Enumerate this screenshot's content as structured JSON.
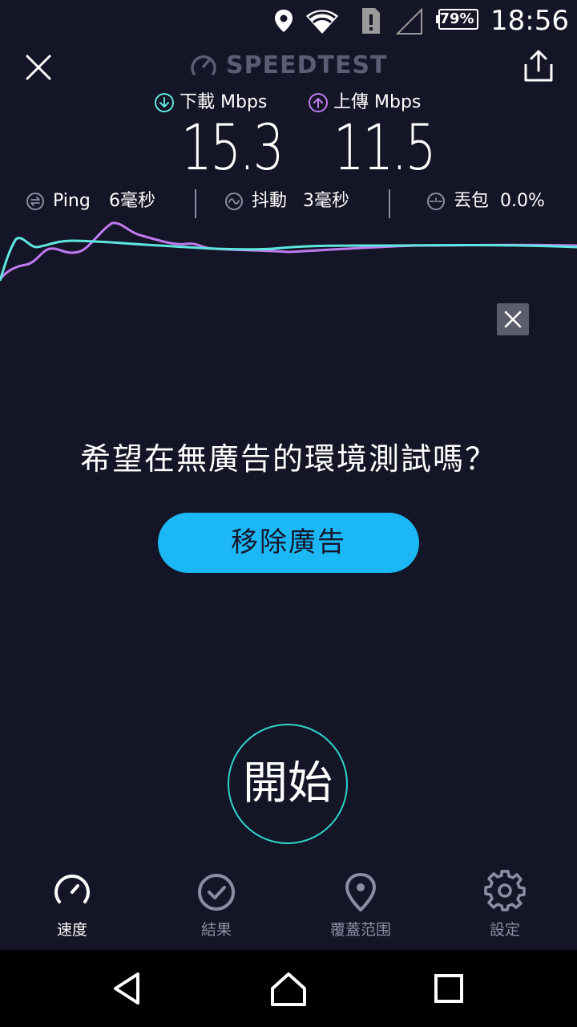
{
  "status_bar": {
    "battery": "79%",
    "time": "18:56",
    "icons": [
      "location-icon",
      "wifi-icon",
      "sim-icon",
      "signal-icon",
      "battery-icon"
    ]
  },
  "header": {
    "title": "SPEEDTEST",
    "close_icon": "close-icon",
    "share_icon": "share-icon"
  },
  "results": {
    "download": {
      "label": "下載 Mbps",
      "value": "15.3",
      "color": "#5ee7df"
    },
    "upload": {
      "label": "上傳 Mbps",
      "value": "11.5",
      "color": "#bf7af0"
    },
    "ping": {
      "label": "Ping",
      "value": "6毫秒"
    },
    "jitter": {
      "label": "抖動",
      "value": "3毫秒"
    },
    "packet_loss": {
      "label": "丟包",
      "value": "0.0%"
    }
  },
  "ad": {
    "question": "希望在無廣告的環境測試嗎？",
    "remove_button": "移除廣告"
  },
  "start_button": "開始",
  "bottom_nav": {
    "items": [
      {
        "label": "速度",
        "icon": "speedometer-icon",
        "active": true
      },
      {
        "label": "結果",
        "icon": "check-circle-icon",
        "active": false
      },
      {
        "label": "覆蓋范围",
        "icon": "map-pin-icon",
        "active": false
      },
      {
        "label": "設定",
        "icon": "gear-icon",
        "active": false
      }
    ]
  },
  "system_nav": [
    "back-icon",
    "home-icon",
    "recents-icon"
  ],
  "colors": {
    "background": "#141526",
    "accent_download": "#5ee7df",
    "accent_upload": "#bf7af0",
    "button": "#1cb8f6",
    "start_ring": "#2fd6c9"
  }
}
